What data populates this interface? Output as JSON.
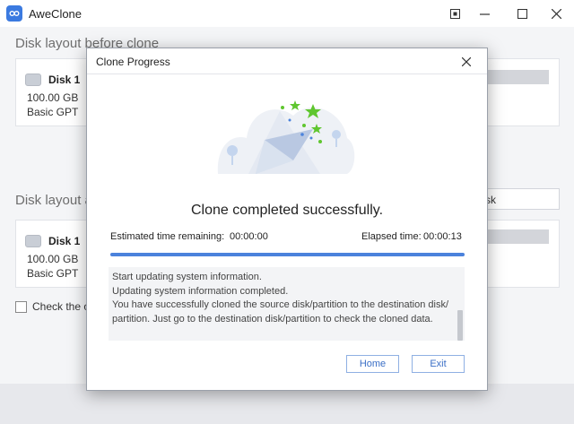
{
  "window": {
    "title": "AweClone"
  },
  "colors": {
    "accent": "#4b82dc",
    "button_border": "#8fb0e3",
    "star_green": "#5fc62f"
  },
  "main": {
    "section_before": "Disk layout before clone",
    "section_after": "Disk layout a",
    "disk_before": {
      "name": "Disk 1",
      "size": "100.00 GB",
      "type": "Basic GPT"
    },
    "disk_after": {
      "name": "Disk 1",
      "size": "100.00 GB",
      "type": "Basic GPT"
    },
    "select_value": "sk",
    "checkbox_label": "Check the op"
  },
  "dialog": {
    "title": "Clone Progress",
    "status": "Clone completed successfully.",
    "estimated_label": "Estimated time remaining:",
    "estimated_value": "00:00:00",
    "elapsed_label": "Elapsed time:",
    "elapsed_value": "00:00:13",
    "progress": 1.0,
    "log": [
      "Start updating system information.",
      "Updating system information completed.",
      "You have successfully cloned the source disk/partition to the destination disk/",
      "partition. Just go to the destination disk/partition to check the cloned data."
    ],
    "home_label": "Home",
    "exit_label": "Exit"
  }
}
